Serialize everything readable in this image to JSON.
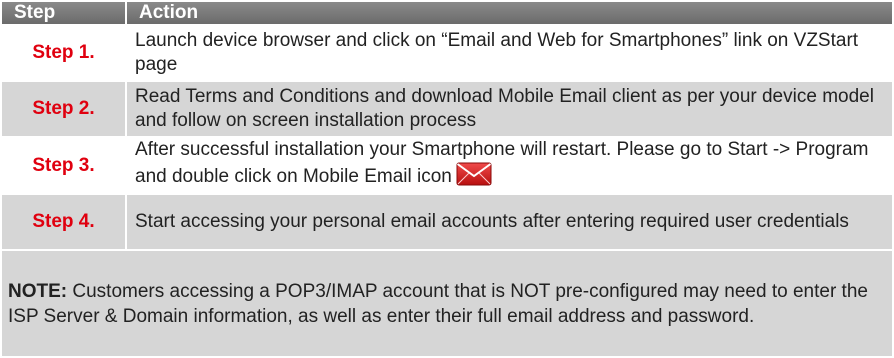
{
  "table": {
    "headers": {
      "step": "Step",
      "action": "Action"
    },
    "rows": [
      {
        "label": "Step 1.",
        "text": "Launch device browser and click on “Email and Web for Smartphones” link on VZStart page"
      },
      {
        "label": "Step 2.",
        "text": "Read Terms and Conditions and download Mobile Email client as per your device model and follow on screen installation process"
      },
      {
        "label": "Step 3.",
        "text": "After successful installation your Smartphone will restart. Please go to Start -> Program and double click on Mobile Email icon"
      },
      {
        "label": "Step 4.",
        "text": "Start accessing your personal email accounts after entering required user credentials"
      }
    ],
    "note": {
      "label": "NOTE:",
      "text": " Customers accessing a POP3/IMAP account that is NOT pre-configured may need to enter the ISP Server & Domain information, as well as enter their full email address and password."
    }
  },
  "icons": {
    "mail": "envelope-icon"
  },
  "colors": {
    "header_bg": "#7a7a7a",
    "step_label": "#e0000f",
    "stripe": "#d6d6d6",
    "icon_red": "#d42020"
  }
}
